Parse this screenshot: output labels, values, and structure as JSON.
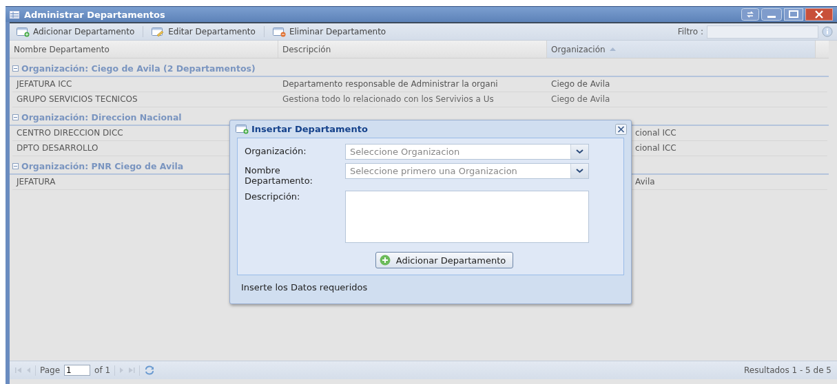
{
  "window": {
    "title": "Administrar Departamentos"
  },
  "toolbar": {
    "buttons": [
      {
        "kind": "add",
        "label": "Adicionar Departamento"
      },
      {
        "kind": "edit",
        "label": "Editar Departamento"
      },
      {
        "kind": "delete",
        "label": "Eliminar Departamento"
      }
    ],
    "filter_label": "Filtro :"
  },
  "grid": {
    "columns": [
      {
        "label": "Nombre Departamento",
        "sorted": false
      },
      {
        "label": "Descripción",
        "sorted": false
      },
      {
        "label": "Organización",
        "sorted": true
      }
    ],
    "groups": [
      {
        "title": "Organización: Ciego de Avila (2 Departamentos)",
        "expanded": true,
        "rows": [
          {
            "name": "JEFATURA ICC",
            "description": "Departamento responsable de Administrar la organi",
            "organization": "Ciego de Avila"
          },
          {
            "name": "GRUPO SERVICIOS TECNICOS",
            "description": "Gestiona todo lo relacionado con los Servivios a Us",
            "organization": "Ciego de Avila"
          }
        ]
      },
      {
        "title": "Organización: Direccion Nacional",
        "expanded": true,
        "rows": [
          {
            "name": "CENTRO DIRECCION DICC",
            "organization": "cional ICC"
          },
          {
            "name": "DPTO DESARROLLO",
            "organization": "cional ICC"
          }
        ]
      },
      {
        "title": "Organización: PNR Ciego de Avila",
        "expanded": true,
        "rows": [
          {
            "name": "JEFATURA",
            "organization": "Avila"
          }
        ]
      }
    ]
  },
  "dialog": {
    "title": "Insertar Departamento",
    "fields": [
      {
        "kind": "combo",
        "label": "Organización:",
        "placeholder": "Seleccione Organizacion"
      },
      {
        "kind": "combo",
        "label": "Nombre Departamento:",
        "placeholder": "Seleccione primero una Organizacion"
      },
      {
        "kind": "textarea",
        "label": "Descripción:"
      }
    ],
    "button": "Adicionar Departamento",
    "status": "Inserte los Datos requeridos"
  },
  "paging": {
    "page_label": "Page",
    "page": "1",
    "of_label": "of 1",
    "results": "Resultados 1 - 5 de 5"
  }
}
